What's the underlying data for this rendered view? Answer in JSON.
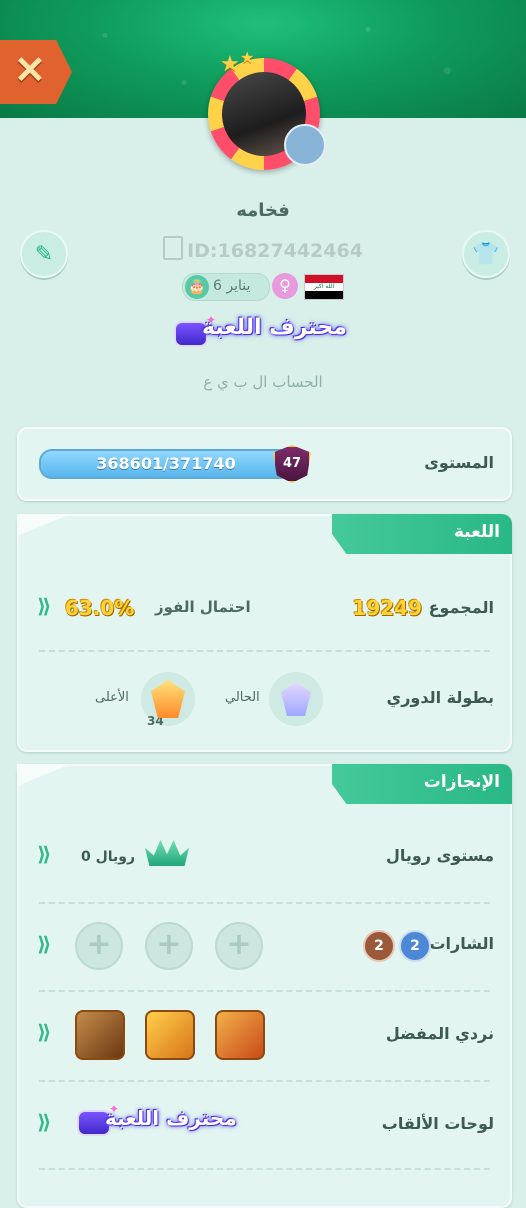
{
  "header": {
    "close_icon": "close-icon",
    "username": "فخامه",
    "user_id": "ID:16827442464",
    "birthday": "6 يناير",
    "gender_icon": "female-icon",
    "country_flag": "iraq-flag",
    "title_badge": "محترف اللعبة",
    "signature": "الحساب ال ب ي ع"
  },
  "level": {
    "label": "المستوى",
    "progress_text": "368601/371740",
    "progress_current": 368601,
    "progress_max": 371740,
    "level_number": "47"
  },
  "game": {
    "section_title": "اللعبة",
    "total_label": "المجموع",
    "total_value": "19249",
    "win_rate_label": "احتمال الفوز",
    "win_rate_value": "63.0%",
    "league_label": "بطولة الدوري",
    "current_label": "الحالي",
    "highest_label": "الأعلى",
    "highest_rank_number": "34"
  },
  "achievements": {
    "section_title": "الإنجازات",
    "royal_level_label": "مستوى رويال",
    "royal_value": "رويال 0",
    "badges_label": "الشارات",
    "badge_counts": [
      "2",
      "2"
    ],
    "dice_label": "نردي المفضل",
    "titles_label": "لوحات الألقاب",
    "titles_badge": "محترف اللعبة"
  },
  "colors": {
    "accent": "#29b886",
    "gold": "#ffd23a",
    "background": "#d9efe9"
  }
}
